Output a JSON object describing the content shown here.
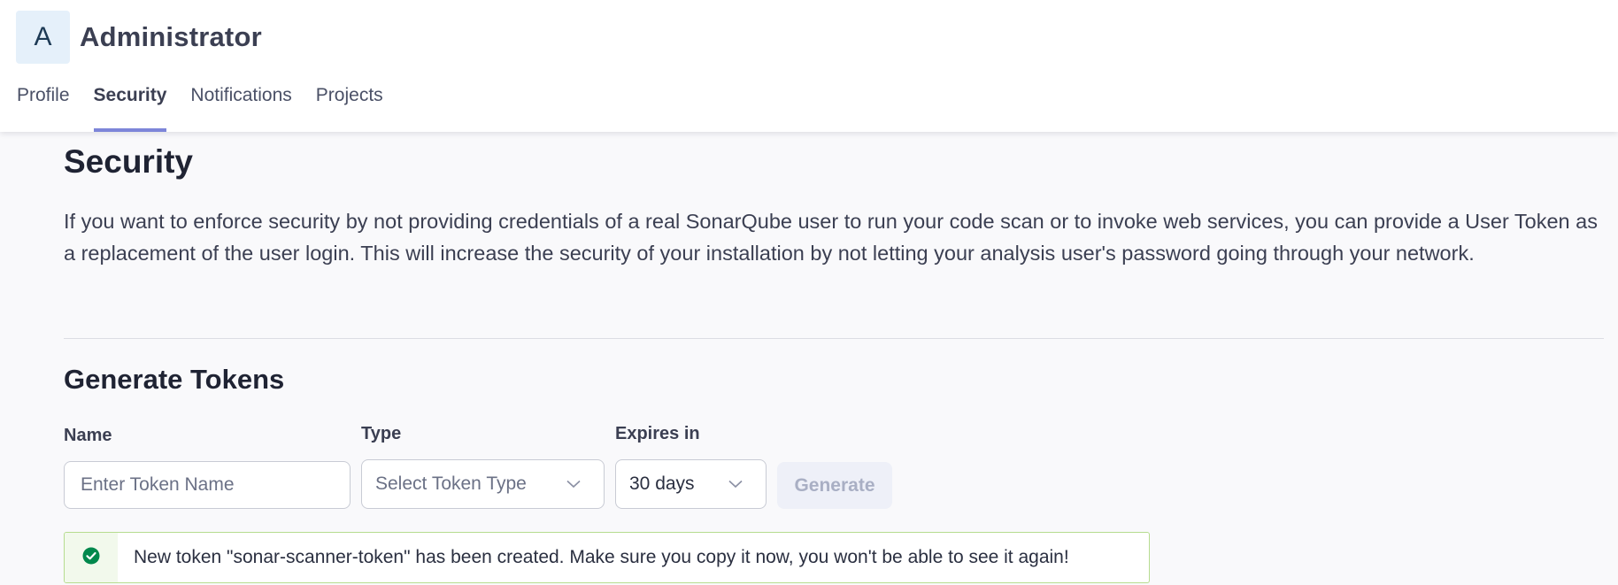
{
  "header": {
    "avatar_letter": "A",
    "user_name": "Administrator",
    "tabs": [
      {
        "label": "Profile",
        "active": false
      },
      {
        "label": "Security",
        "active": true
      },
      {
        "label": "Notifications",
        "active": false
      },
      {
        "label": "Projects",
        "active": false
      }
    ]
  },
  "main": {
    "title": "Security",
    "description": "If you want to enforce security by not providing credentials of a real SonarQube user to run your code scan or to invoke web services, you can provide a User Token as a replacement of the user login. This will increase the security of your installation by not letting your analysis user's password going through your network.",
    "generate": {
      "title": "Generate Tokens",
      "name_label": "Name",
      "name_placeholder": "Enter Token Name",
      "type_label": "Type",
      "type_placeholder": "Select Token Type",
      "expires_label": "Expires in",
      "expires_value": "30 days",
      "generate_label": "Generate"
    },
    "banner": {
      "message": "New token \"sonar-scanner-token\" has been created. Make sure you copy it now, you won't be able to see it again!",
      "status": "success"
    }
  },
  "colors": {
    "accent": "#7d85d9",
    "success_icon": "#00884c",
    "success_border": "#b6dc8f",
    "avatar_bg": "#e5f0fa"
  },
  "icons": {
    "dropdown": "chevron-down-icon",
    "success": "check-circle-icon"
  }
}
